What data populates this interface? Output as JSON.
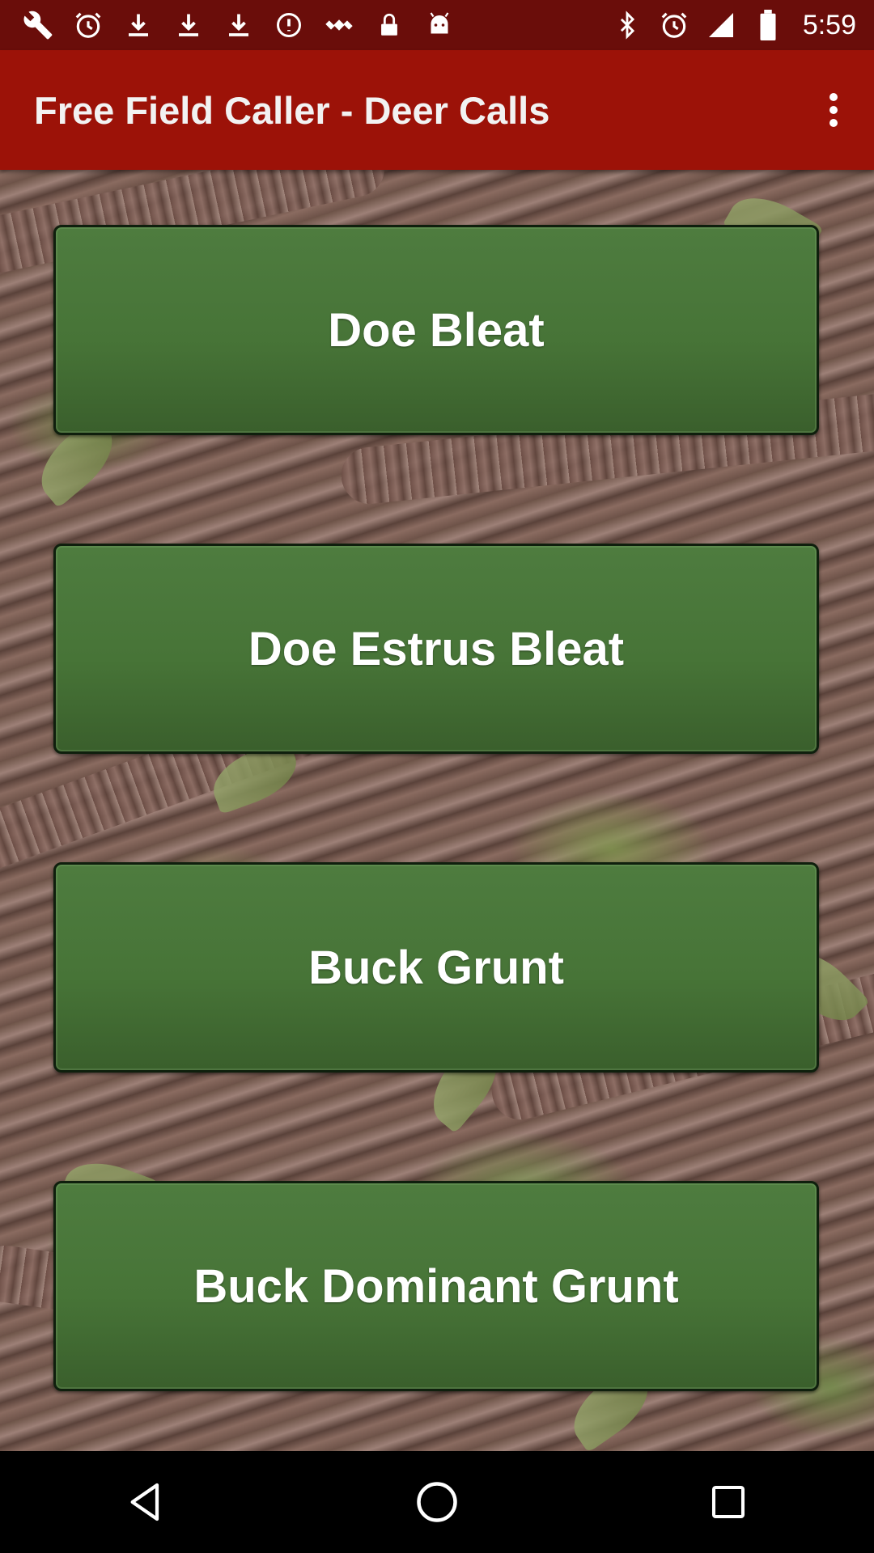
{
  "status_bar": {
    "time": "5:59",
    "left_icons": [
      "wrench-icon",
      "alarm-icon",
      "download-icon",
      "download-icon",
      "download-icon",
      "info-icon",
      "satellite-icon",
      "lock-icon",
      "android-icon"
    ],
    "right_icons": [
      "bluetooth-icon",
      "alarm-icon"
    ],
    "background_color": "#6a0d0a"
  },
  "app_bar": {
    "title": "Free Field Caller - Deer Calls",
    "menu_icon": "more-vert-icon",
    "background_color": "#9c1208"
  },
  "calls": [
    {
      "label": "Doe Bleat"
    },
    {
      "label": "Doe Estrus Bleat"
    },
    {
      "label": "Buck Grunt"
    },
    {
      "label": "Buck Dominant Grunt"
    }
  ],
  "button_color": "#477437",
  "nav_bar": {
    "icons": [
      "back-icon",
      "home-icon",
      "recents-icon"
    ]
  }
}
